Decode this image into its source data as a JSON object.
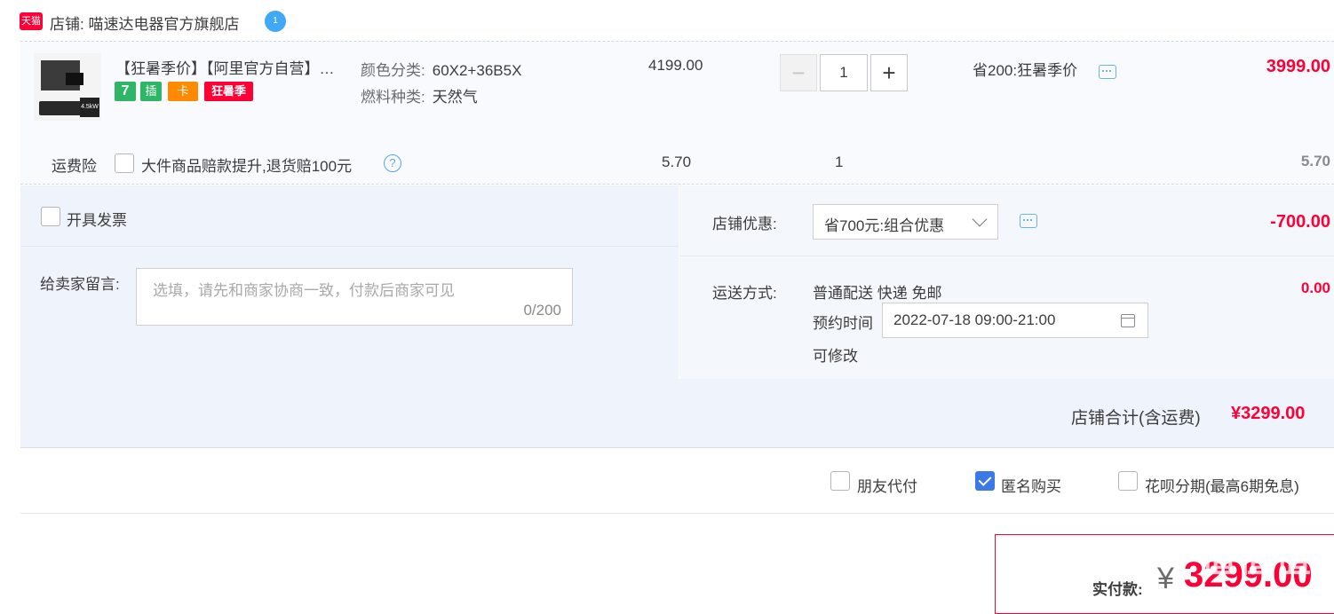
{
  "shop": {
    "logo_text": "天猫",
    "label": "店铺: 喵速达电器官方旗舰店",
    "wangwang_badge": "1"
  },
  "item": {
    "title": "【狂暑季价】【阿里官方自营】…",
    "badges": [
      "7",
      "插",
      "卡",
      "狂暑季"
    ],
    "sku": [
      {
        "label": "颜色分类:",
        "value": "60X2+36B5X"
      },
      {
        "label": "燃料种类:",
        "value": "天然气"
      }
    ],
    "unit_price": "4199.00",
    "quantity": "1",
    "qty_minus": "−",
    "qty_plus": "+",
    "promo": "省200:狂暑季价",
    "subtotal": "3999.00"
  },
  "insurance": {
    "label": "运费险",
    "option": "大件商品赔款提升,退货赔100元",
    "help": "?",
    "price": "5.70",
    "quantity": "1",
    "subtotal": "5.70"
  },
  "invoice": {
    "label": "开具发票"
  },
  "message": {
    "label": "给卖家留言:",
    "placeholder": "选填，请先和商家协商一致，付款后商家可见",
    "count": "0/200"
  },
  "discount": {
    "label": "店铺优惠:",
    "selected": "省700元:组合优惠",
    "amount": "-700.00"
  },
  "shipping": {
    "label": "运送方式:",
    "method": "普通配送 快递 免邮",
    "appoint_label": "预约时间",
    "appoint_value": "2022-07-18 09:00-21:00",
    "modifiable": "可修改",
    "amount": "0.00"
  },
  "shop_total": {
    "label": "店铺合计(含运费)",
    "amount": "¥3299.00"
  },
  "pay_options": [
    {
      "label": "朋友代付",
      "checked": false
    },
    {
      "label": "匿名购买",
      "checked": true
    },
    {
      "label": "花呗分期(最高6期免息)",
      "checked": false
    }
  ],
  "payment": {
    "label": "实付款:",
    "currency": "¥",
    "amount": "3299.00"
  },
  "watermark": "值值值",
  "colors": {
    "accent_red": "#ff0036",
    "link_blue": "#3b7ae6",
    "panel_bg": "#eff3fb"
  }
}
